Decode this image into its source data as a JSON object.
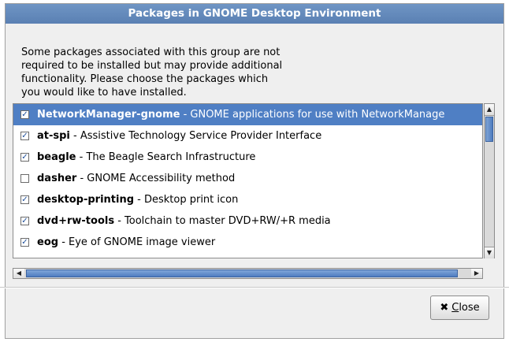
{
  "dialog": {
    "title": "Packages in GNOME Desktop Environment",
    "description_lines": [
      "Some packages associated with this group are not",
      "required to be installed but may provide additional",
      "functionality.  Please choose the packages which",
      "you would like to have installed."
    ]
  },
  "packages": [
    {
      "name": "NetworkManager-gnome",
      "desc": " - GNOME applications for use with NetworkManage",
      "checked": true,
      "selected": true
    },
    {
      "name": "at-spi",
      "desc": " - Assistive Technology Service Provider Interface",
      "checked": true,
      "selected": false
    },
    {
      "name": "beagle",
      "desc": " - The Beagle Search Infrastructure",
      "checked": true,
      "selected": false
    },
    {
      "name": "dasher",
      "desc": " - GNOME Accessibility method",
      "checked": false,
      "selected": false
    },
    {
      "name": "desktop-printing",
      "desc": " - Desktop print icon",
      "checked": true,
      "selected": false
    },
    {
      "name": "dvd+rw-tools",
      "desc": " - Toolchain to master DVD+RW/+R media",
      "checked": true,
      "selected": false
    },
    {
      "name": "eog",
      "desc": " - Eye of GNOME image viewer",
      "checked": true,
      "selected": false
    }
  ],
  "scrollbars": {
    "up_arrow": "▲",
    "down_arrow": "▼",
    "left_arrow": "◀",
    "right_arrow": "▶"
  },
  "buttons": {
    "close_icon": "✖",
    "close_label_prefix": "",
    "close_label_mnemonic": "C",
    "close_label_rest": "lose"
  },
  "check_glyph": "✓"
}
